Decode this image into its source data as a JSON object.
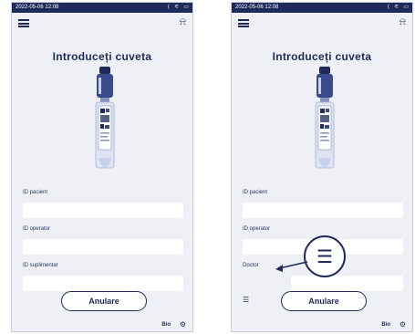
{
  "screens": [
    {
      "status_time": "2022-05-06 12:08",
      "title": "Introduceți cuveta",
      "fields": [
        {
          "label": "ID pacient"
        },
        {
          "label": "ID operator"
        },
        {
          "label": "ID suplimentar"
        }
      ],
      "cancel_label": "Anulare",
      "brand": "Bio"
    },
    {
      "status_time": "2022-05-06 12:08",
      "title": "Introduceți cuveta",
      "fields": [
        {
          "label": "ID pacient"
        },
        {
          "label": "ID operator"
        },
        {
          "label": "Doctor"
        }
      ],
      "cancel_label": "Anulare",
      "brand": "Bio"
    }
  ],
  "icons": {
    "menu": "hamburger-menu-icon",
    "bell": "bell-icon",
    "list": "list-icon",
    "footer": "settings-icon"
  },
  "colors": {
    "primary": "#1f2a5a",
    "screen_bg": "#eef0f6",
    "input_bg": "#ffffff"
  }
}
